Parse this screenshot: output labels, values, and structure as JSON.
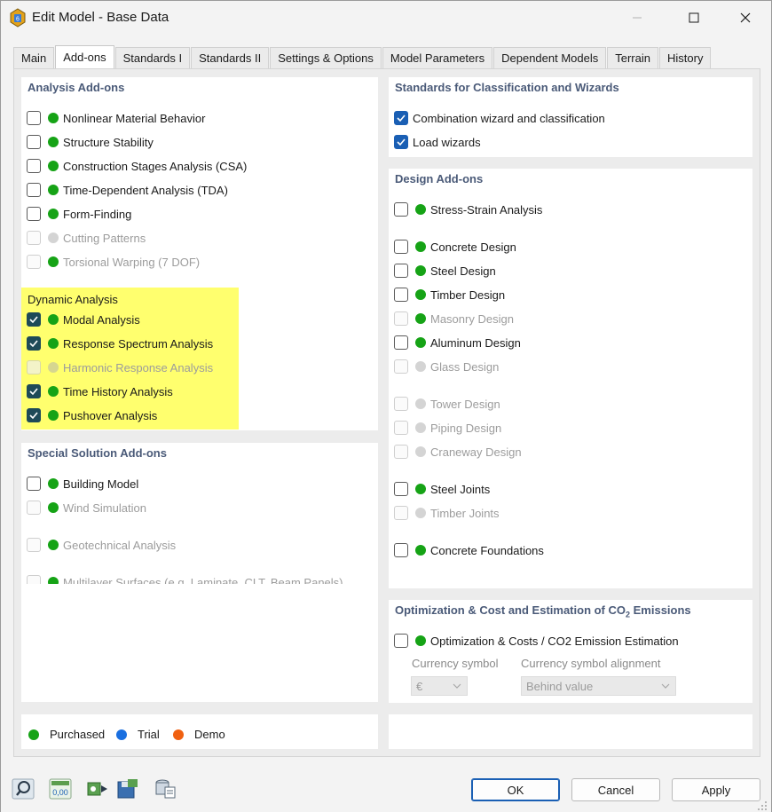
{
  "window": {
    "title": "Edit Model - Base Data"
  },
  "tabs": [
    {
      "label": "Main"
    },
    {
      "label": "Add-ons"
    },
    {
      "label": "Standards I"
    },
    {
      "label": "Standards II"
    },
    {
      "label": "Settings & Options"
    },
    {
      "label": "Model Parameters"
    },
    {
      "label": "Dependent Models"
    },
    {
      "label": "Terrain"
    },
    {
      "label": "History"
    }
  ],
  "analysis": {
    "title": "Analysis Add-ons",
    "items": [
      {
        "label": "Nonlinear Material Behavior",
        "checked": false,
        "enabled": true
      },
      {
        "label": "Structure Stability",
        "checked": false,
        "enabled": true
      },
      {
        "label": "Construction Stages Analysis (CSA)",
        "checked": false,
        "enabled": true
      },
      {
        "label": "Time-Dependent Analysis (TDA)",
        "checked": false,
        "enabled": true
      },
      {
        "label": "Form-Finding",
        "checked": false,
        "enabled": true
      },
      {
        "label": "Cutting Patterns",
        "checked": false,
        "enabled": false
      },
      {
        "label": "Torsional Warping (7 DOF)",
        "checked": false,
        "enabled": false
      }
    ],
    "dynamic_title": "Dynamic Analysis",
    "dynamic_items": [
      {
        "label": "Modal Analysis",
        "checked": true,
        "enabled": true
      },
      {
        "label": "Response Spectrum Analysis",
        "checked": true,
        "enabled": true
      },
      {
        "label": "Harmonic Response Analysis",
        "checked": false,
        "enabled": false
      },
      {
        "label": "Time History Analysis",
        "checked": true,
        "enabled": true
      },
      {
        "label": "Pushover Analysis",
        "checked": true,
        "enabled": true
      }
    ]
  },
  "special": {
    "title": "Special Solution Add-ons",
    "items": [
      {
        "label": "Building Model",
        "checked": false,
        "enabled": true
      },
      {
        "label": "Wind Simulation",
        "checked": false,
        "enabled": false
      },
      {
        "label": "Geotechnical Analysis",
        "checked": false,
        "enabled": false
      },
      {
        "label": "Multilayer Surfaces (e.g. Laminate, CLT, Beam Panels)",
        "checked": false,
        "enabled": false
      }
    ]
  },
  "standards": {
    "title": "Standards for Classification and Wizards",
    "items": [
      {
        "label": "Combination wizard and classification",
        "checked": true
      },
      {
        "label": "Load wizards",
        "checked": true
      }
    ]
  },
  "design": {
    "title": "Design Add-ons",
    "items": [
      {
        "label": "Stress-Strain Analysis",
        "checked": false,
        "enabled": true
      },
      {
        "label": "Concrete Design",
        "checked": false,
        "enabled": true
      },
      {
        "label": "Steel Design",
        "checked": false,
        "enabled": true
      },
      {
        "label": "Timber Design",
        "checked": false,
        "enabled": true
      },
      {
        "label": "Masonry Design",
        "checked": false,
        "enabled": false
      },
      {
        "label": "Aluminum Design",
        "checked": false,
        "enabled": true
      },
      {
        "label": "Glass Design",
        "checked": false,
        "enabled": false
      },
      {
        "label": "Tower Design",
        "checked": false,
        "enabled": false
      },
      {
        "label": "Piping Design",
        "checked": false,
        "enabled": false
      },
      {
        "label": "Craneway Design",
        "checked": false,
        "enabled": false
      },
      {
        "label": "Steel Joints",
        "checked": false,
        "enabled": true
      },
      {
        "label": "Timber Joints",
        "checked": false,
        "enabled": false
      },
      {
        "label": "Concrete Foundations",
        "checked": false,
        "enabled": true
      }
    ]
  },
  "optimization": {
    "title_part1": "Optimization & Cost and Estimation of CO",
    "title_sub": "2",
    "title_part2": " Emissions",
    "item_label": "Optimization & Costs / CO2 Emission Estimation",
    "currency_label": "Currency symbol",
    "currency_value": "€",
    "alignment_label": "Currency symbol alignment",
    "alignment_value": "Behind value"
  },
  "legend": {
    "purchased": "Purchased",
    "trial": "Trial",
    "demo": "Demo"
  },
  "buttons": {
    "ok": "OK",
    "cancel": "Cancel",
    "apply": "Apply"
  },
  "toolbar": {
    "units_icon_text": "0,00"
  },
  "colors": {
    "purchased": "#16a316",
    "trial": "#1a6fe0",
    "demo": "#f06010",
    "highlight": "#ffff6e",
    "section_title": "#4a5a78"
  }
}
